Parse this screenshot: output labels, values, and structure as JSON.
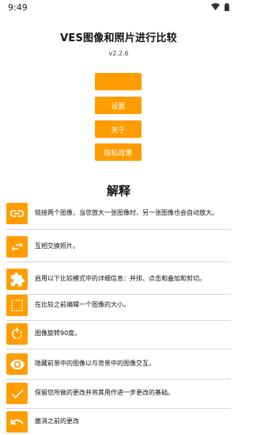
{
  "status_bar": {
    "time": "9:49"
  },
  "header": {
    "title": "VES图像和照片进行比较",
    "version": "v2.2.6"
  },
  "buttons": {
    "primary_label": "",
    "settings_label": "设置",
    "about_label": "关于",
    "privacy_label": "隐私政策"
  },
  "explain": {
    "title": "解释",
    "items": [
      {
        "icon": "link-icon",
        "text": "链接两个图像，当您放大一张图像时，另一张图像也会自动放大。"
      },
      {
        "icon": "swap-icon",
        "text": "互相交换照片。"
      },
      {
        "icon": "puzzle-icon",
        "text": "启用以下比较模式中的详细信息：并排、点击和叠加和剪切。"
      },
      {
        "icon": "crop-icon",
        "text": "在比较之前编辑一个图像的大小。"
      },
      {
        "icon": "rotate-icon",
        "text": "图像旋转90度。"
      },
      {
        "icon": "eye-icon",
        "text": "隐藏前景中的图像以与背景中的图像交互。"
      },
      {
        "icon": "check-icon",
        "text": "保留您所做的更改并将其用作进一步更改的基础。"
      },
      {
        "icon": "undo-icon",
        "text": "撤消之前的更改"
      }
    ]
  },
  "colors": {
    "accent": "#ff9c00",
    "text": "#111111",
    "divider": "#d6d6d6"
  }
}
